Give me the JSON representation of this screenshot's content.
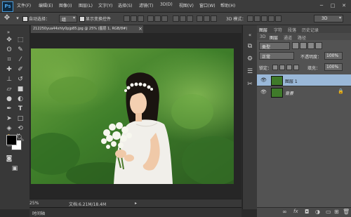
{
  "app": {
    "logo": "Ps"
  },
  "menu": [
    "文件(F)",
    "编辑(E)",
    "图像(I)",
    "图层(L)",
    "文字(Y)",
    "选择(S)",
    "滤镜(T)",
    "3D(D)",
    "视图(V)",
    "窗口(W)",
    "帮助(H)"
  ],
  "window_controls": [
    "─",
    "□",
    "✕"
  ],
  "options": {
    "auto_select_label": "自动选择：",
    "auto_select_value": "组",
    "show_transform_label": "显示变换控件",
    "mode_3d_label": "3D 模式：",
    "workspace": "3D"
  },
  "document": {
    "tab_title": "212250yua44xhly0pjp85.jpg @ 25% (图层 1, RGB/8#)",
    "close_label": "×"
  },
  "status": {
    "zoom": "25%",
    "doc_info": "文档:6.21M/18.4M",
    "arrow": "▸"
  },
  "timeline": {
    "label": "时间轴"
  },
  "layers_panel": {
    "tabs": [
      "图层",
      "字符",
      "段落",
      "历史记录"
    ],
    "subtabs": [
      "3D",
      "图层",
      "通道",
      "路径"
    ],
    "kind_filter": "类型",
    "blend_mode": "正常",
    "opacity_label": "不透明度：",
    "opacity_value": "100%",
    "lock_label": "锁定：",
    "fill_label": "填充：",
    "fill_value": "100%",
    "layers": [
      {
        "name": "图层 1",
        "selected": true
      },
      {
        "name": "背景",
        "selected": false
      }
    ],
    "lock_icon": "🔒"
  },
  "colors": {
    "accent": "#4aa3e8",
    "selected_layer": "#9ab8d8",
    "panel_bg": "#535353"
  }
}
